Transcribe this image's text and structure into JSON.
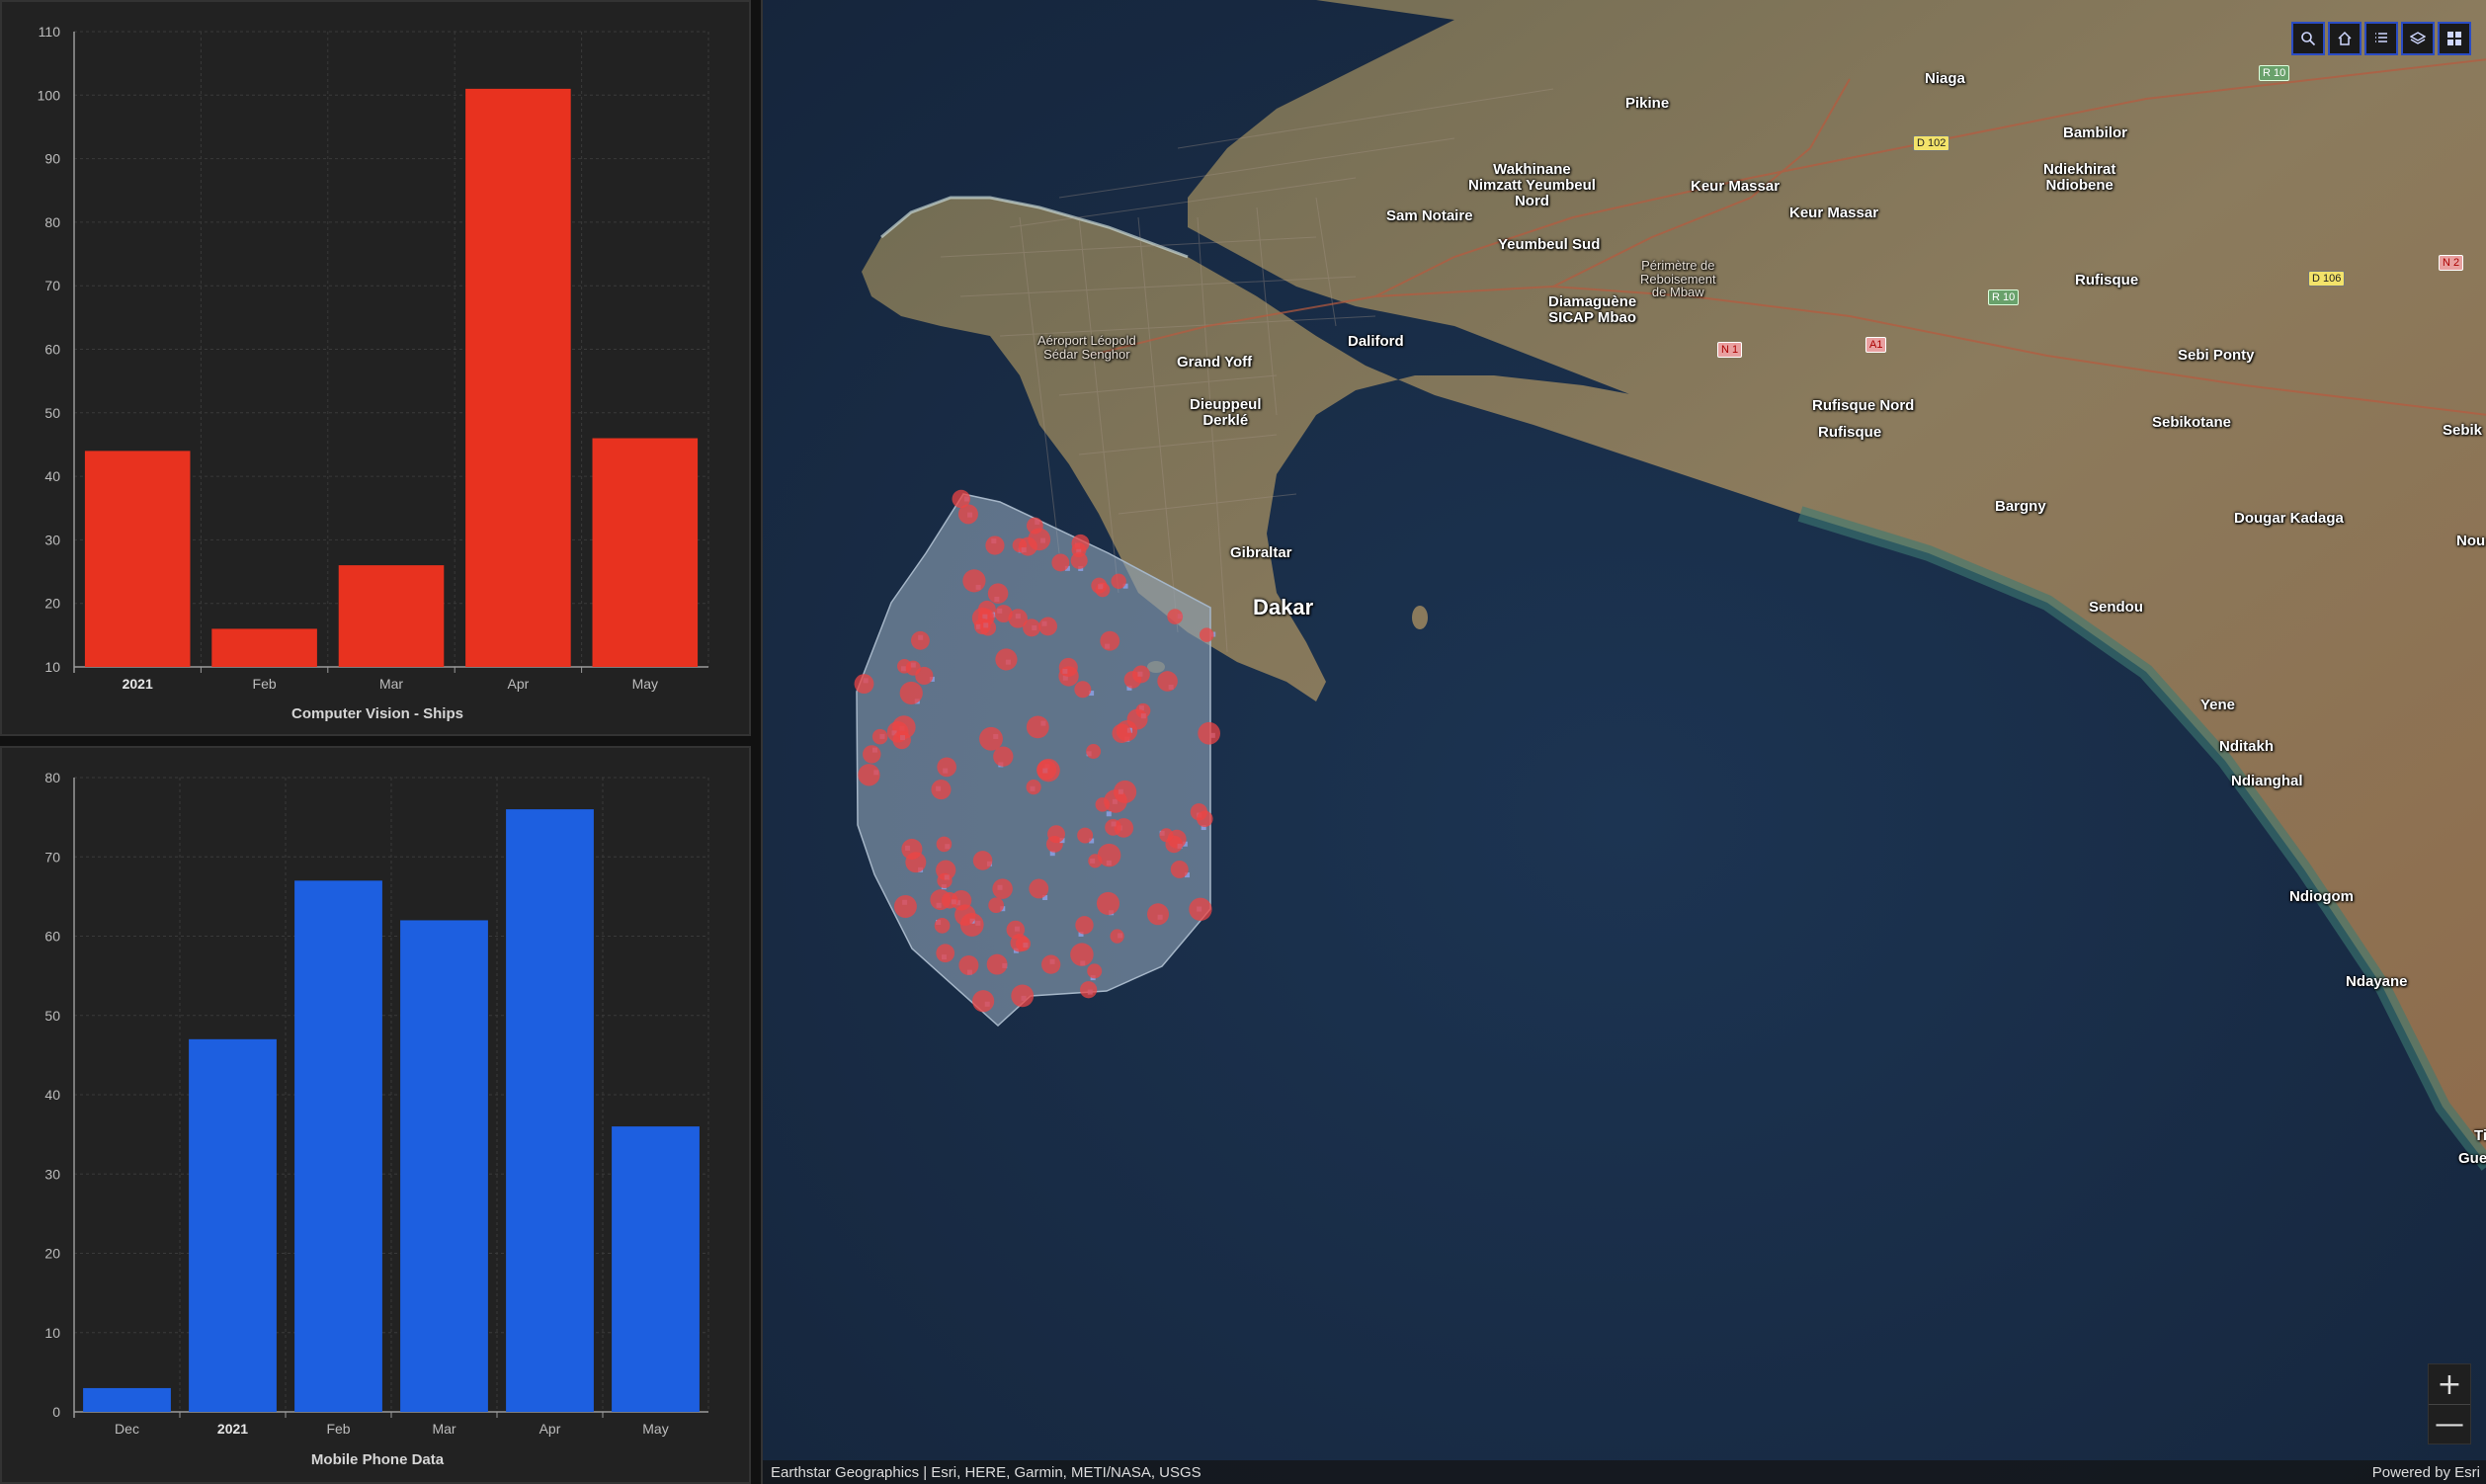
{
  "chart_data": [
    {
      "type": "bar",
      "title": "Computer Vision - Ships",
      "categories": [
        "2021",
        "Feb",
        "Mar",
        "Apr",
        "May"
      ],
      "values": [
        44,
        16,
        26,
        101,
        46
      ],
      "ylim": [
        10,
        110
      ],
      "yticks": [
        10,
        20,
        30,
        40,
        50,
        60,
        70,
        80,
        90,
        100,
        110
      ],
      "bold_categories": [
        "2021"
      ],
      "color": "#e8321f",
      "grid": true
    },
    {
      "type": "bar",
      "title": "Mobile Phone Data",
      "categories": [
        "Dec",
        "2021",
        "Feb",
        "Mar",
        "Apr",
        "May"
      ],
      "values": [
        3,
        47,
        67,
        62,
        76,
        36
      ],
      "ylim": [
        0,
        80
      ],
      "yticks": [
        0,
        10,
        20,
        30,
        40,
        50,
        60,
        70,
        80
      ],
      "bold_categories": [
        "2021"
      ],
      "color": "#1d5fe0",
      "grid": true
    }
  ],
  "map": {
    "labels": [
      {
        "key": "niaga",
        "text": "Niaga"
      },
      {
        "key": "pikine",
        "text": "Pikine"
      },
      {
        "key": "bambilor",
        "text": "Bambilor"
      },
      {
        "key": "wakhinane",
        "text": "Wakhinane\nNimzatt Yeumbeul\nNord"
      },
      {
        "key": "keur_massar1",
        "text": "Keur Massar"
      },
      {
        "key": "ndiekhirat",
        "text": "Ndiekhirat\nNdiobene"
      },
      {
        "key": "sam_notaire",
        "text": "Sam Notaire"
      },
      {
        "key": "keur_massar2",
        "text": "Keur Massar"
      },
      {
        "key": "yeumbeul_sud",
        "text": "Yeumbeul Sud"
      },
      {
        "key": "rufisque",
        "text": "Rufisque"
      },
      {
        "key": "perimetre",
        "text": "Périmètre de\nReboisement\nde Mbaw"
      },
      {
        "key": "diamaguene",
        "text": "Diamaguène\nSICAP Mbao"
      },
      {
        "key": "aeroport",
        "text": "Aéroport Léopold\nSédar Senghor"
      },
      {
        "key": "daliford",
        "text": "Daliford"
      },
      {
        "key": "grand_yoff",
        "text": "Grand Yoff"
      },
      {
        "key": "sebi_ponty",
        "text": "Sebi Ponty"
      },
      {
        "key": "dieuppeul",
        "text": "Dieuppeul\nDerklé"
      },
      {
        "key": "rufisque_nord",
        "text": "Rufisque Nord"
      },
      {
        "key": "rufisque2",
        "text": "Rufisque"
      },
      {
        "key": "sebikotane",
        "text": "Sebikotane"
      },
      {
        "key": "sebik_edge",
        "text": "Sebik"
      },
      {
        "key": "bargny",
        "text": "Bargny"
      },
      {
        "key": "dougar",
        "text": "Dougar Kadaga"
      },
      {
        "key": "nou",
        "text": "Nou"
      },
      {
        "key": "gibraltar",
        "text": "Gibraltar"
      },
      {
        "key": "dakar",
        "text": "Dakar"
      },
      {
        "key": "sendou",
        "text": "Sendou"
      },
      {
        "key": "yene",
        "text": "Yene"
      },
      {
        "key": "nditakh",
        "text": "Nditakh"
      },
      {
        "key": "ndianghal",
        "text": "Ndianghal"
      },
      {
        "key": "ndiogom",
        "text": "Ndiogom"
      },
      {
        "key": "ndayane",
        "text": "Ndayane"
      },
      {
        "key": "ti",
        "text": "Ti"
      },
      {
        "key": "gue",
        "text": "Gue"
      }
    ],
    "shields": [
      {
        "key": "r10a",
        "text": "R 10",
        "style": "green"
      },
      {
        "key": "d102",
        "text": "D 102",
        "style": "yellow"
      },
      {
        "key": "n2",
        "text": "N 2",
        "style": "red"
      },
      {
        "key": "d106",
        "text": "D 106",
        "style": "yellow"
      },
      {
        "key": "r10b",
        "text": "R 10",
        "style": "green"
      },
      {
        "key": "n1",
        "text": "N 1",
        "style": "red"
      },
      {
        "key": "a1",
        "text": "A1",
        "style": "red"
      }
    ],
    "toolbar_icons": [
      "search-icon",
      "home-icon",
      "list-icon",
      "layers-icon",
      "basemap-gallery-icon"
    ],
    "zoom_in": "+",
    "zoom_out": "—",
    "attribution": "Earthstar Geographics | Esri, HERE, Garmin, METI/NASA, USGS",
    "powered_by": "Powered by Esri",
    "colors": {
      "ocean": "#1a2c45",
      "land": "#8a7a5c",
      "polygon_fill": "#8fa3b8",
      "point_red": "#ec4444",
      "point_square": "#8fa3e8"
    }
  }
}
